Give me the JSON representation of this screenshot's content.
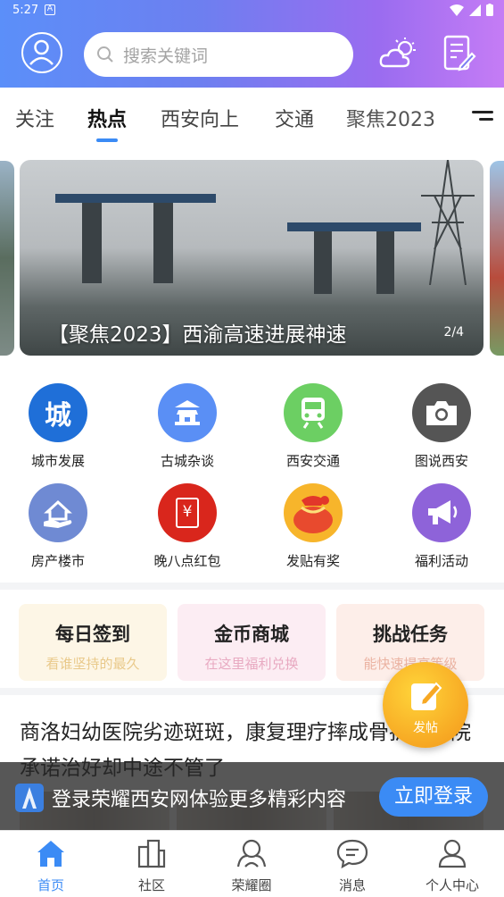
{
  "status": {
    "time": "5:27",
    "notif_glyph": "A"
  },
  "header": {
    "search_placeholder": "搜索关键词"
  },
  "tabs": [
    {
      "label": "关注",
      "active": false
    },
    {
      "label": "热点",
      "active": true
    },
    {
      "label": "西安向上",
      "active": false
    },
    {
      "label": "交通",
      "active": false
    },
    {
      "label": "聚焦2023",
      "active": false
    }
  ],
  "banner": {
    "caption": "【聚焦2023】西渝高速进展神速",
    "pager": "2/4"
  },
  "grid": [
    {
      "label": "城市发展",
      "icon": "city-icon",
      "icon_text": "城",
      "color": "#1f6fd8"
    },
    {
      "label": "古城杂谈",
      "icon": "ancient-tower-icon",
      "color": "#5a8ff5"
    },
    {
      "label": "西安交通",
      "icon": "train-icon",
      "color": "#6ccf63"
    },
    {
      "label": "图说西安",
      "icon": "camera-icon",
      "color": "#555555"
    },
    {
      "label": "房产楼市",
      "icon": "house-icon",
      "color": "#6f8ad3"
    },
    {
      "label": "晚八点红包",
      "icon": "red-envelope-icon",
      "icon_text": "¥",
      "color": "#d9261c"
    },
    {
      "label": "发贴有奖",
      "icon": "money-bag-icon",
      "color": "#f7b52b"
    },
    {
      "label": "福利活动",
      "icon": "megaphone-icon",
      "color": "#8e63d9"
    }
  ],
  "cards": [
    {
      "title": "每日签到",
      "subtitle": "看谁坚持的最久",
      "bg": "#fdf6e6",
      "sub_color": "#e9c98a"
    },
    {
      "title": "金币商城",
      "subtitle": "在这里福利兑换",
      "bg": "#fcedf3",
      "sub_color": "#e8a9c1"
    },
    {
      "title": "挑战任务",
      "subtitle": "能快速提高等级",
      "bg": "#fdeee9",
      "sub_color": "#ebb3a2"
    }
  ],
  "news": {
    "headline": "商洛妇幼医院劣迹斑斑，康复理疗摔成骨折，医院承诺治好却中途不管了"
  },
  "login_banner": {
    "text": "登录荣耀西安网体验更多精彩内容",
    "button": "立即登录"
  },
  "fab": {
    "label": "发帖"
  },
  "nav": [
    {
      "label": "首页",
      "icon": "home-icon",
      "active": true
    },
    {
      "label": "社区",
      "icon": "community-icon",
      "active": false
    },
    {
      "label": "荣耀圈",
      "icon": "circle-icon",
      "active": false
    },
    {
      "label": "消息",
      "icon": "message-icon",
      "active": false
    },
    {
      "label": "个人中心",
      "icon": "profile-icon",
      "active": false
    }
  ]
}
